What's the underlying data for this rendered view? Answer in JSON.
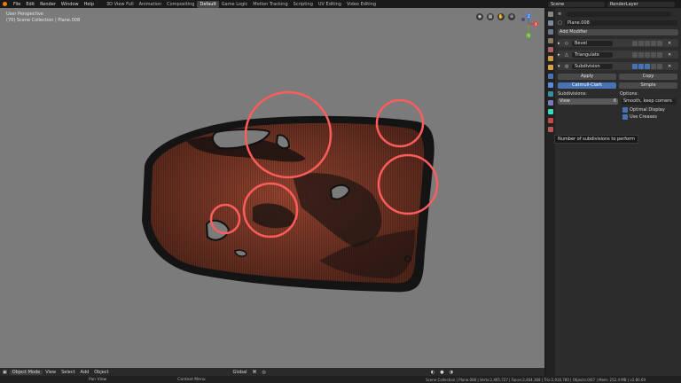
{
  "menu": {
    "items": [
      "File",
      "Edit",
      "Render",
      "Window",
      "Help"
    ]
  },
  "workspaces": [
    "3D View Full",
    "Animation",
    "Compositing",
    "Default",
    "Game Logic",
    "Motion Tracking",
    "Scripting",
    "UV Editing",
    "Video Editing"
  ],
  "active_workspace": "Default",
  "scene": {
    "name": "Scene",
    "render_layer": "RenderLayer"
  },
  "viewport": {
    "view_label": "User Perspective",
    "collection_label": "(70) Scene Collection | Plane.008",
    "axes": {
      "x": "X",
      "y": "Y",
      "z": "Z"
    }
  },
  "bottom": {
    "mode": "Object Mode",
    "menus": [
      "View",
      "Select",
      "Add",
      "Object"
    ],
    "orientation": "Global"
  },
  "statusbar": {
    "left": "Pan View",
    "middle": "Context Menu",
    "stats": "Scene Collection | Plane.008 | Verts:2,465,727 | Faces:2,464,368 | Tris:2,916,780 | Objects:0/67 | Mem: 252.4 MB | v2.80.69"
  },
  "properties": {
    "object_name": "Plane.008",
    "add_modifier": "Add Modifier",
    "modifiers": [
      {
        "name": "Bevel"
      },
      {
        "name": "Triangulate"
      },
      {
        "name": "Subdivision"
      }
    ],
    "apply_label": "Apply",
    "copy_label": "Copy",
    "method_a": "Catmull-Clark",
    "method_b": "Simple",
    "subdivisions_label": "Subdivisions:",
    "options_label": "Options:",
    "view_field": "View",
    "view_value": "6",
    "render_field": "Render",
    "uv_smooth": "Smooth, keep corners",
    "optimal_display": "Optimal Display",
    "use_creases": "Use Creases",
    "tooltip": "Number of subdivisions to perform"
  },
  "colors": {
    "viewport_bg": "#7b7b7b",
    "mesh_copper": "#b8563a",
    "highlight_circle": "#ff5c5c",
    "accent_blue": "#4772b3",
    "blender_orange": "#e87d0d"
  }
}
